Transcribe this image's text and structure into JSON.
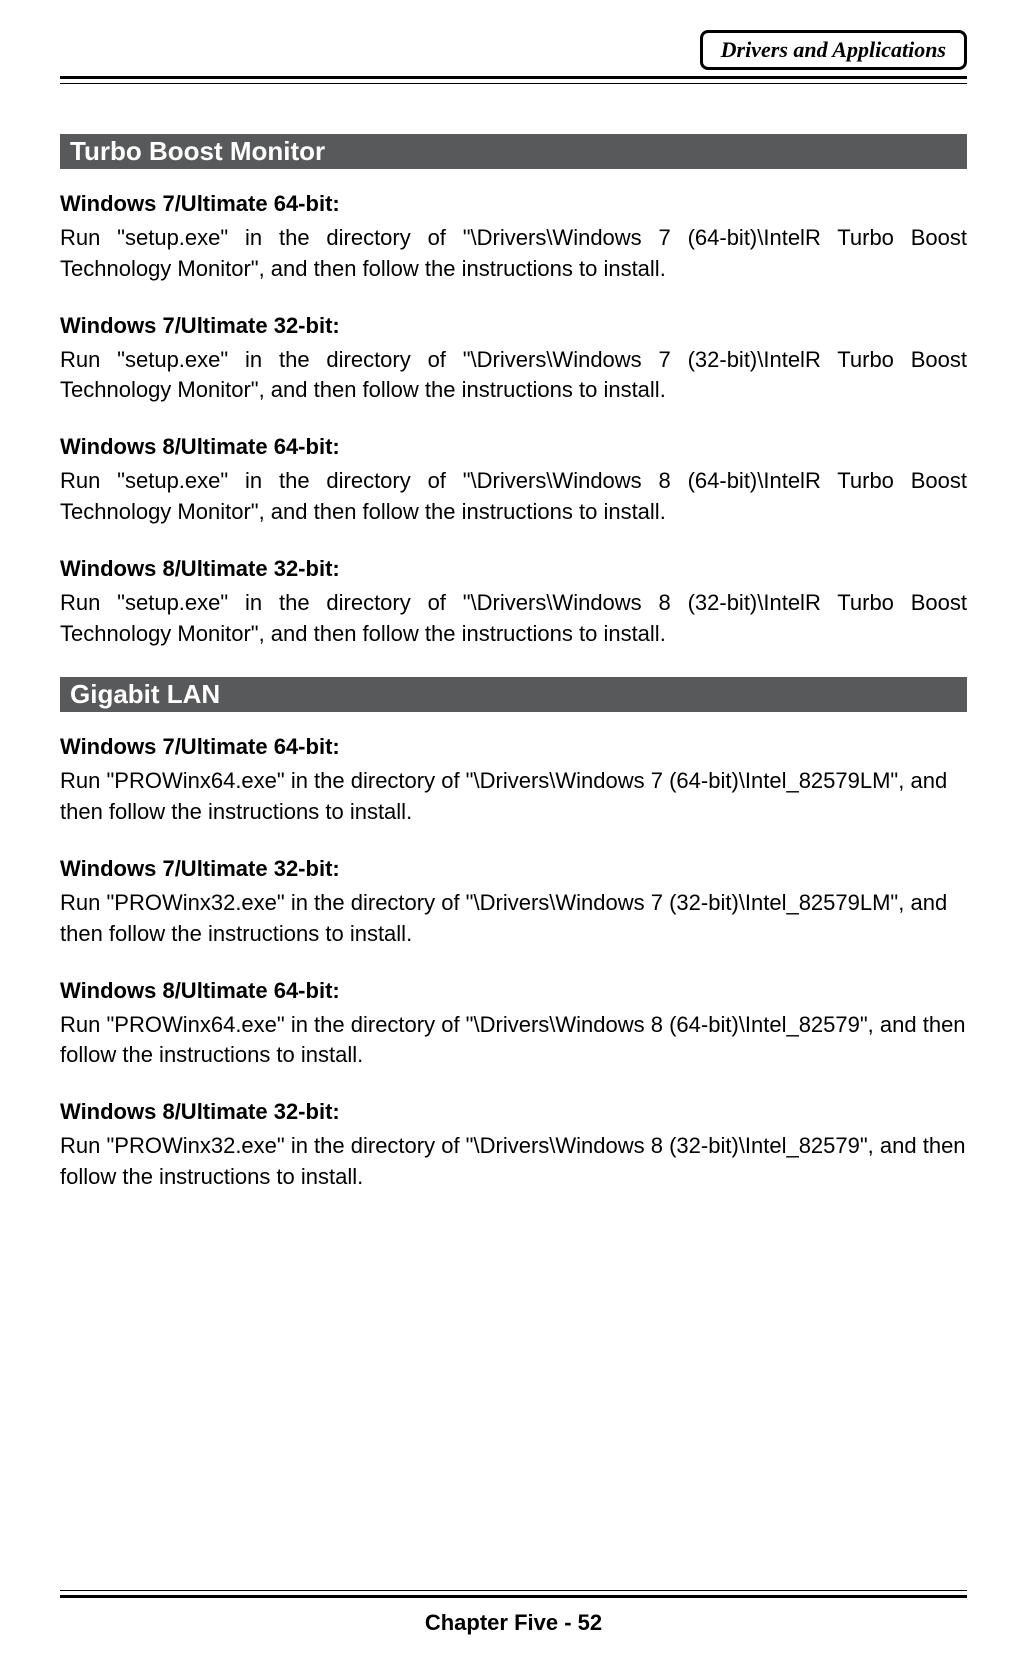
{
  "header": {
    "badge": "Drivers and Applications"
  },
  "sections": [
    {
      "title": "Turbo Boost Monitor",
      "items": [
        {
          "subhead": "Windows 7/Ultimate 64-bit:",
          "body": "Run \"setup.exe\" in the directory of \"\\Drivers\\Windows 7 (64-bit)\\IntelR Turbo Boost Technology Monitor\", and then follow the instructions to install.",
          "justify": true
        },
        {
          "subhead": "Windows 7/Ultimate 32-bit:",
          "body": "Run \"setup.exe\" in the directory of \"\\Drivers\\Windows 7 (32-bit)\\IntelR Turbo Boost Technology Monitor\", and then follow the instructions to install.",
          "justify": true
        },
        {
          "subhead": "Windows 8/Ultimate 64-bit:",
          "body": "Run \"setup.exe\" in the directory of \"\\Drivers\\Windows 8 (64-bit)\\IntelR Turbo Boost Technology Monitor\", and then follow the instructions to install.",
          "justify": true
        },
        {
          "subhead": "Windows 8/Ultimate 32-bit:",
          "body": "Run \"setup.exe\" in the directory of \"\\Drivers\\Windows 8 (32-bit)\\IntelR Turbo Boost Technology Monitor\", and then follow the instructions to install.",
          "justify": true
        }
      ]
    },
    {
      "title": "Gigabit LAN",
      "items": [
        {
          "subhead": "Windows 7/Ultimate 64-bit:",
          "body": "Run \"PROWinx64.exe\" in the directory of \"\\Drivers\\Windows 7 (64-bit)\\Intel_82579LM\", and then follow the instructions to install.",
          "justify": false
        },
        {
          "subhead": "Windows 7/Ultimate 32-bit:",
          "body": "Run \"PROWinx32.exe\" in the directory of \"\\Drivers\\Windows 7 (32-bit)\\Intel_82579LM\", and then follow the instructions to install.",
          "justify": false
        },
        {
          "subhead": "Windows 8/Ultimate 64-bit:",
          "body": "Run \"PROWinx64.exe\" in the directory of \"\\Drivers\\Windows 8 (64-bit)\\Intel_82579\", and then follow the instructions to install.",
          "justify": false
        },
        {
          "subhead": "Windows 8/Ultimate 32-bit:",
          "body": "Run \"PROWinx32.exe\" in the directory of \"\\Drivers\\Windows 8 (32-bit)\\Intel_82579\", and then follow the instructions to install.",
          "justify": false
        }
      ]
    }
  ],
  "footer": {
    "page_label": "Chapter Five - 52"
  }
}
